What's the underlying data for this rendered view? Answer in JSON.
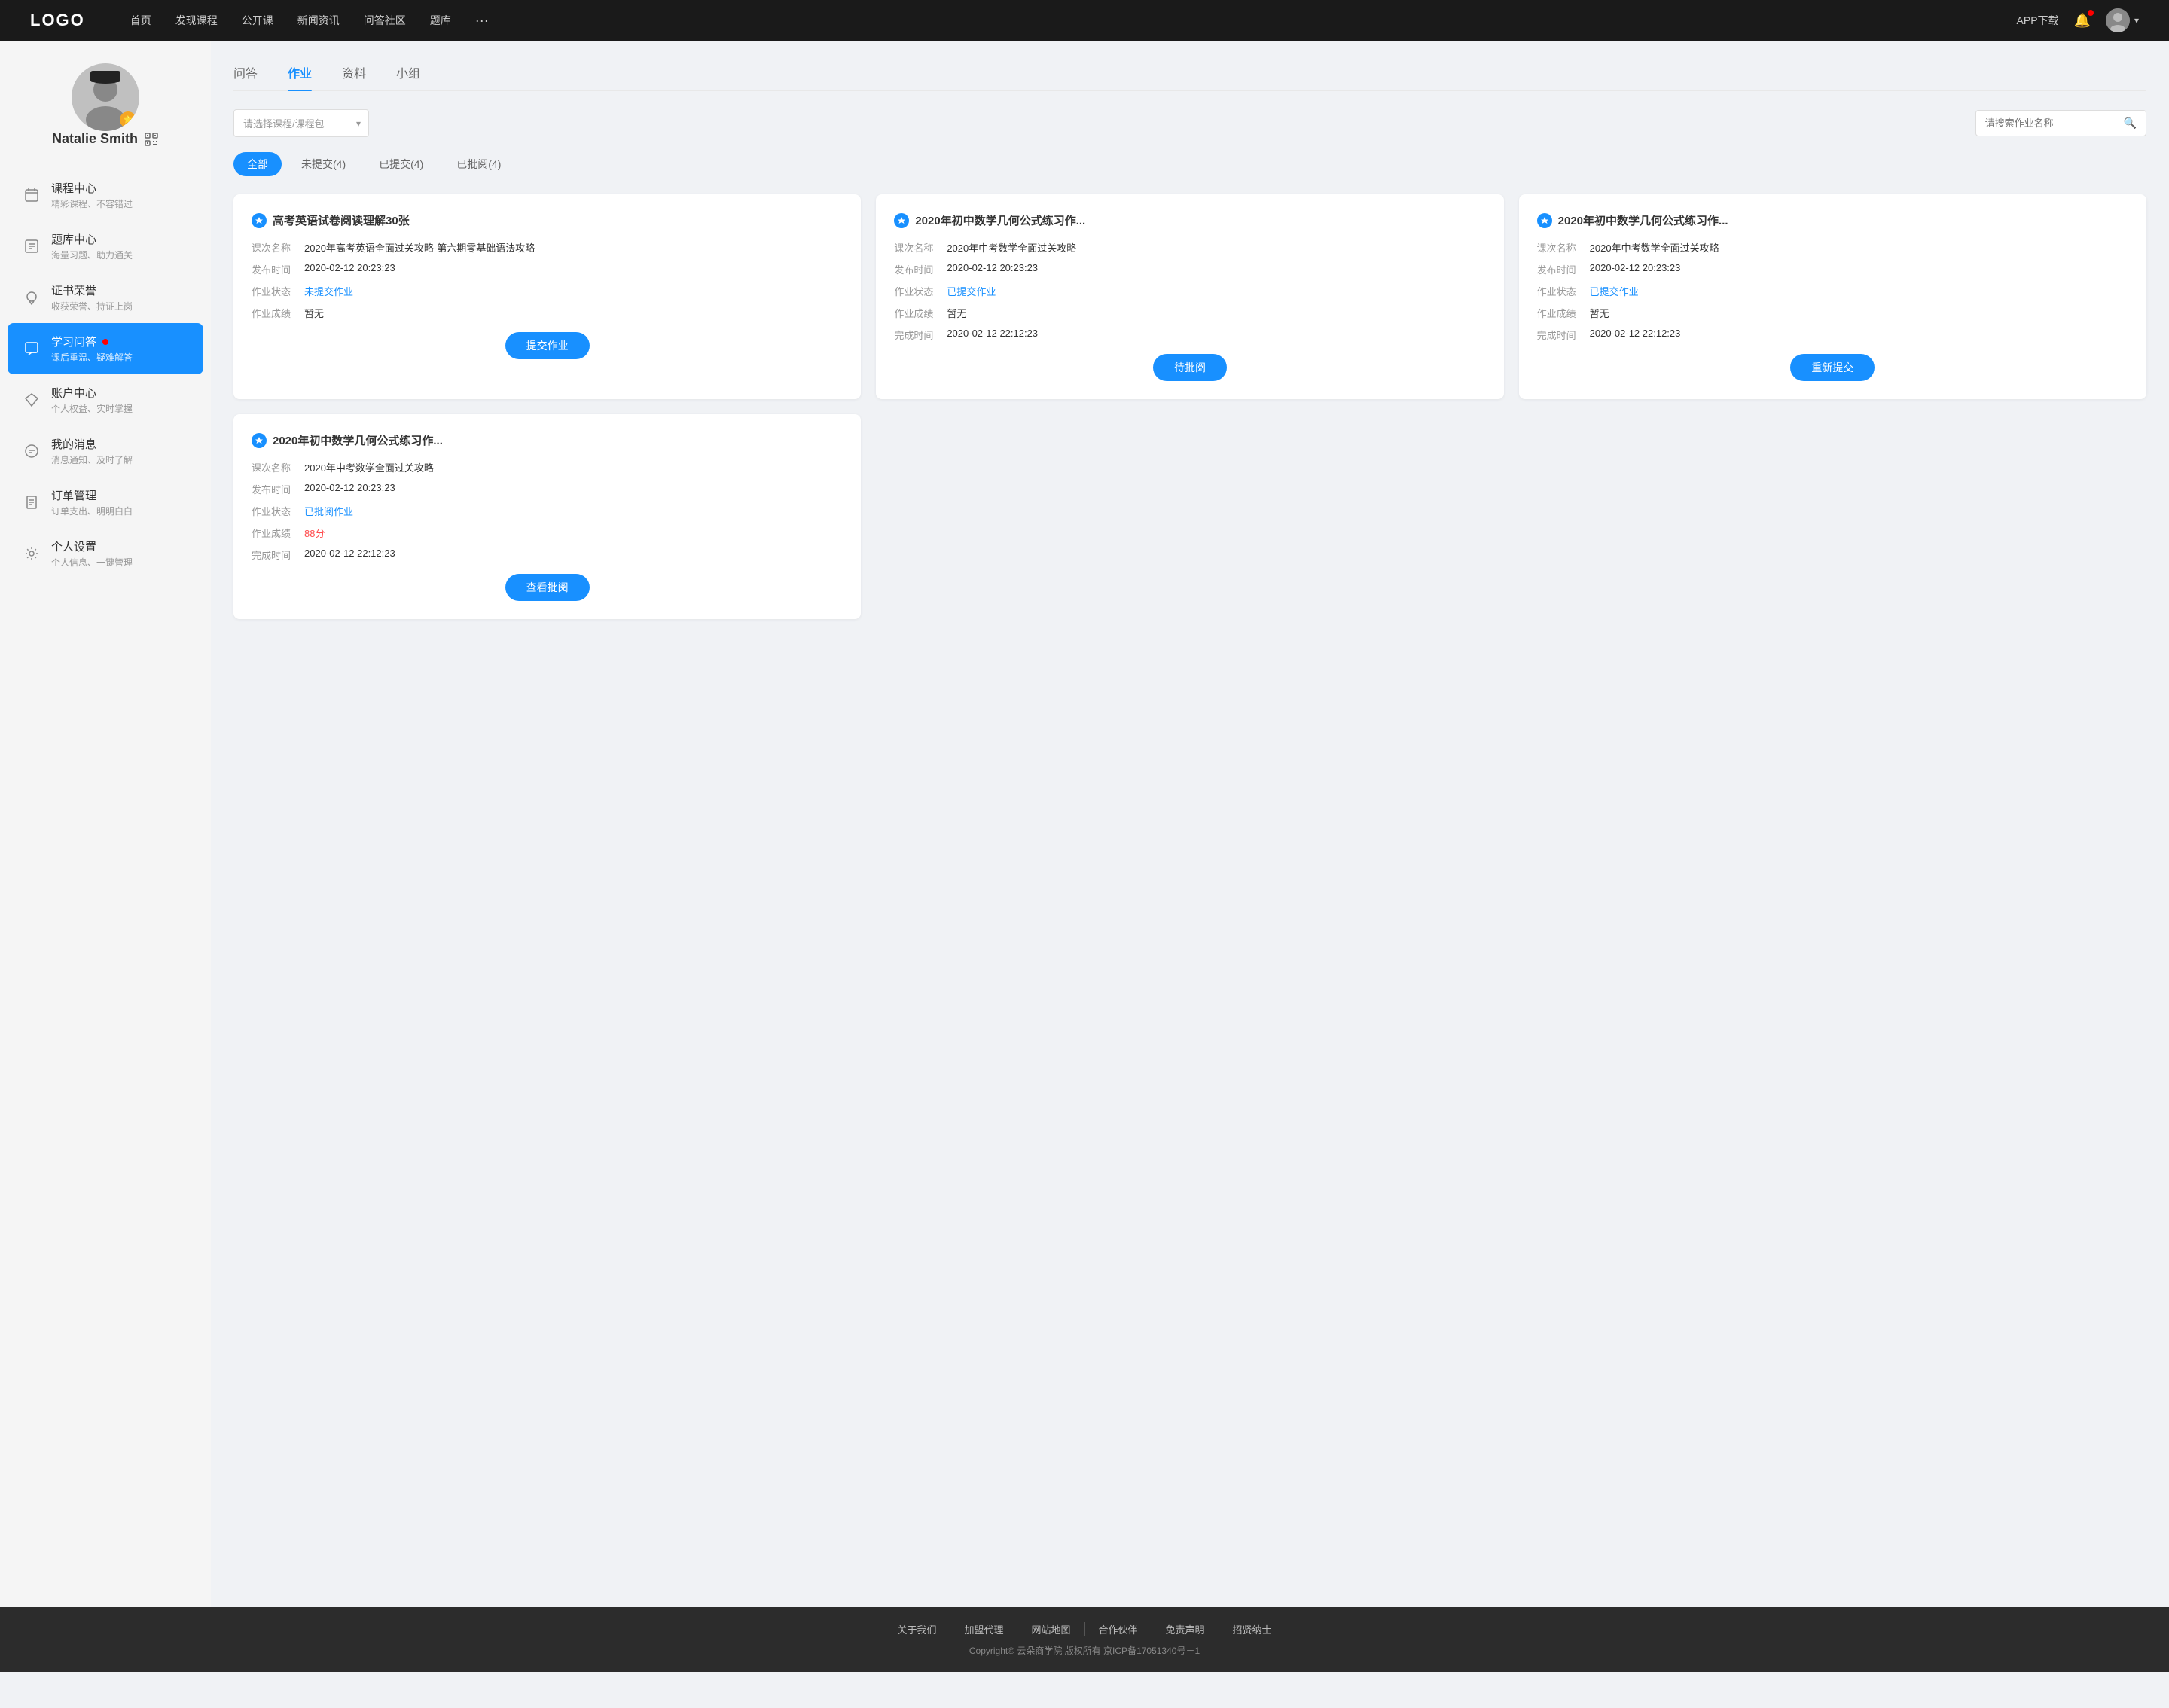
{
  "header": {
    "logo": "LOGO",
    "nav": [
      "首页",
      "发现课程",
      "公开课",
      "新闻资讯",
      "问答社区",
      "题库",
      "···"
    ],
    "app_download": "APP下载"
  },
  "sidebar": {
    "profile": {
      "name": "Natalie Smith"
    },
    "menu": [
      {
        "id": "course-center",
        "label": "课程中心",
        "sub": "精彩课程、不容错过",
        "icon": "calendar"
      },
      {
        "id": "question-bank",
        "label": "题库中心",
        "sub": "海量习题、助力通关",
        "icon": "list"
      },
      {
        "id": "certificate",
        "label": "证书荣誉",
        "sub": "收获荣誉、持证上岗",
        "icon": "badge"
      },
      {
        "id": "qa",
        "label": "学习问答",
        "sub": "课后重温、疑难解答",
        "icon": "chat",
        "active": true,
        "dot": true
      },
      {
        "id": "account",
        "label": "账户中心",
        "sub": "个人权益、实时掌握",
        "icon": "diamond"
      },
      {
        "id": "messages",
        "label": "我的消息",
        "sub": "消息通知、及时了解",
        "icon": "message"
      },
      {
        "id": "orders",
        "label": "订单管理",
        "sub": "订单支出、明明白白",
        "icon": "document"
      },
      {
        "id": "settings",
        "label": "个人设置",
        "sub": "个人信息、一键管理",
        "icon": "gear"
      }
    ]
  },
  "tabs": [
    "问答",
    "作业",
    "资料",
    "小组"
  ],
  "active_tab": "作业",
  "filter": {
    "dropdown_placeholder": "请选择课程/课程包",
    "search_placeholder": "请搜索作业名称"
  },
  "status_tabs": [
    {
      "label": "全部",
      "active": true
    },
    {
      "label": "未提交(4)",
      "active": false
    },
    {
      "label": "已提交(4)",
      "active": false
    },
    {
      "label": "已批阅(4)",
      "active": false
    }
  ],
  "homework_cards": [
    {
      "title": "高考英语试卷阅读理解30张",
      "course_name": "2020年高考英语全面过关攻略-第六期零基础语法攻略",
      "publish_time": "2020-02-12 20:23:23",
      "status_label": "未提交作业",
      "status_type": "not_submitted",
      "score": "暂无",
      "complete_time": null,
      "action_label": "提交作业"
    },
    {
      "title": "2020年初中数学几何公式练习作...",
      "course_name": "2020年中考数学全面过关攻略",
      "publish_time": "2020-02-12 20:23:23",
      "status_label": "已提交作业",
      "status_type": "submitted",
      "score": "暂无",
      "complete_time": "2020-02-12 22:12:23",
      "action_label": "待批阅"
    },
    {
      "title": "2020年初中数学几何公式练习作...",
      "course_name": "2020年中考数学全面过关攻略",
      "publish_time": "2020-02-12 20:23:23",
      "status_label": "已提交作业",
      "status_type": "submitted",
      "score": "暂无",
      "complete_time": "2020-02-12 22:12:23",
      "action_label": "重新提交"
    },
    {
      "title": "2020年初中数学几何公式练习作...",
      "course_name": "2020年中考数学全面过关攻略",
      "publish_time": "2020-02-12 20:23:23",
      "status_label": "已批阅作业",
      "status_type": "reviewed",
      "score": "88分",
      "complete_time": "2020-02-12 22:12:23",
      "action_label": "查看批阅"
    }
  ],
  "field_labels": {
    "course_name": "课次名称",
    "publish_time": "发布时间",
    "status": "作业状态",
    "score": "作业成绩",
    "complete_time": "完成时间"
  },
  "footer": {
    "links": [
      "关于我们",
      "加盟代理",
      "网站地图",
      "合作伙伴",
      "免责声明",
      "招贤纳士"
    ],
    "copyright": "Copyright© 云朵商学院  版权所有    京ICP备17051340号－1"
  }
}
